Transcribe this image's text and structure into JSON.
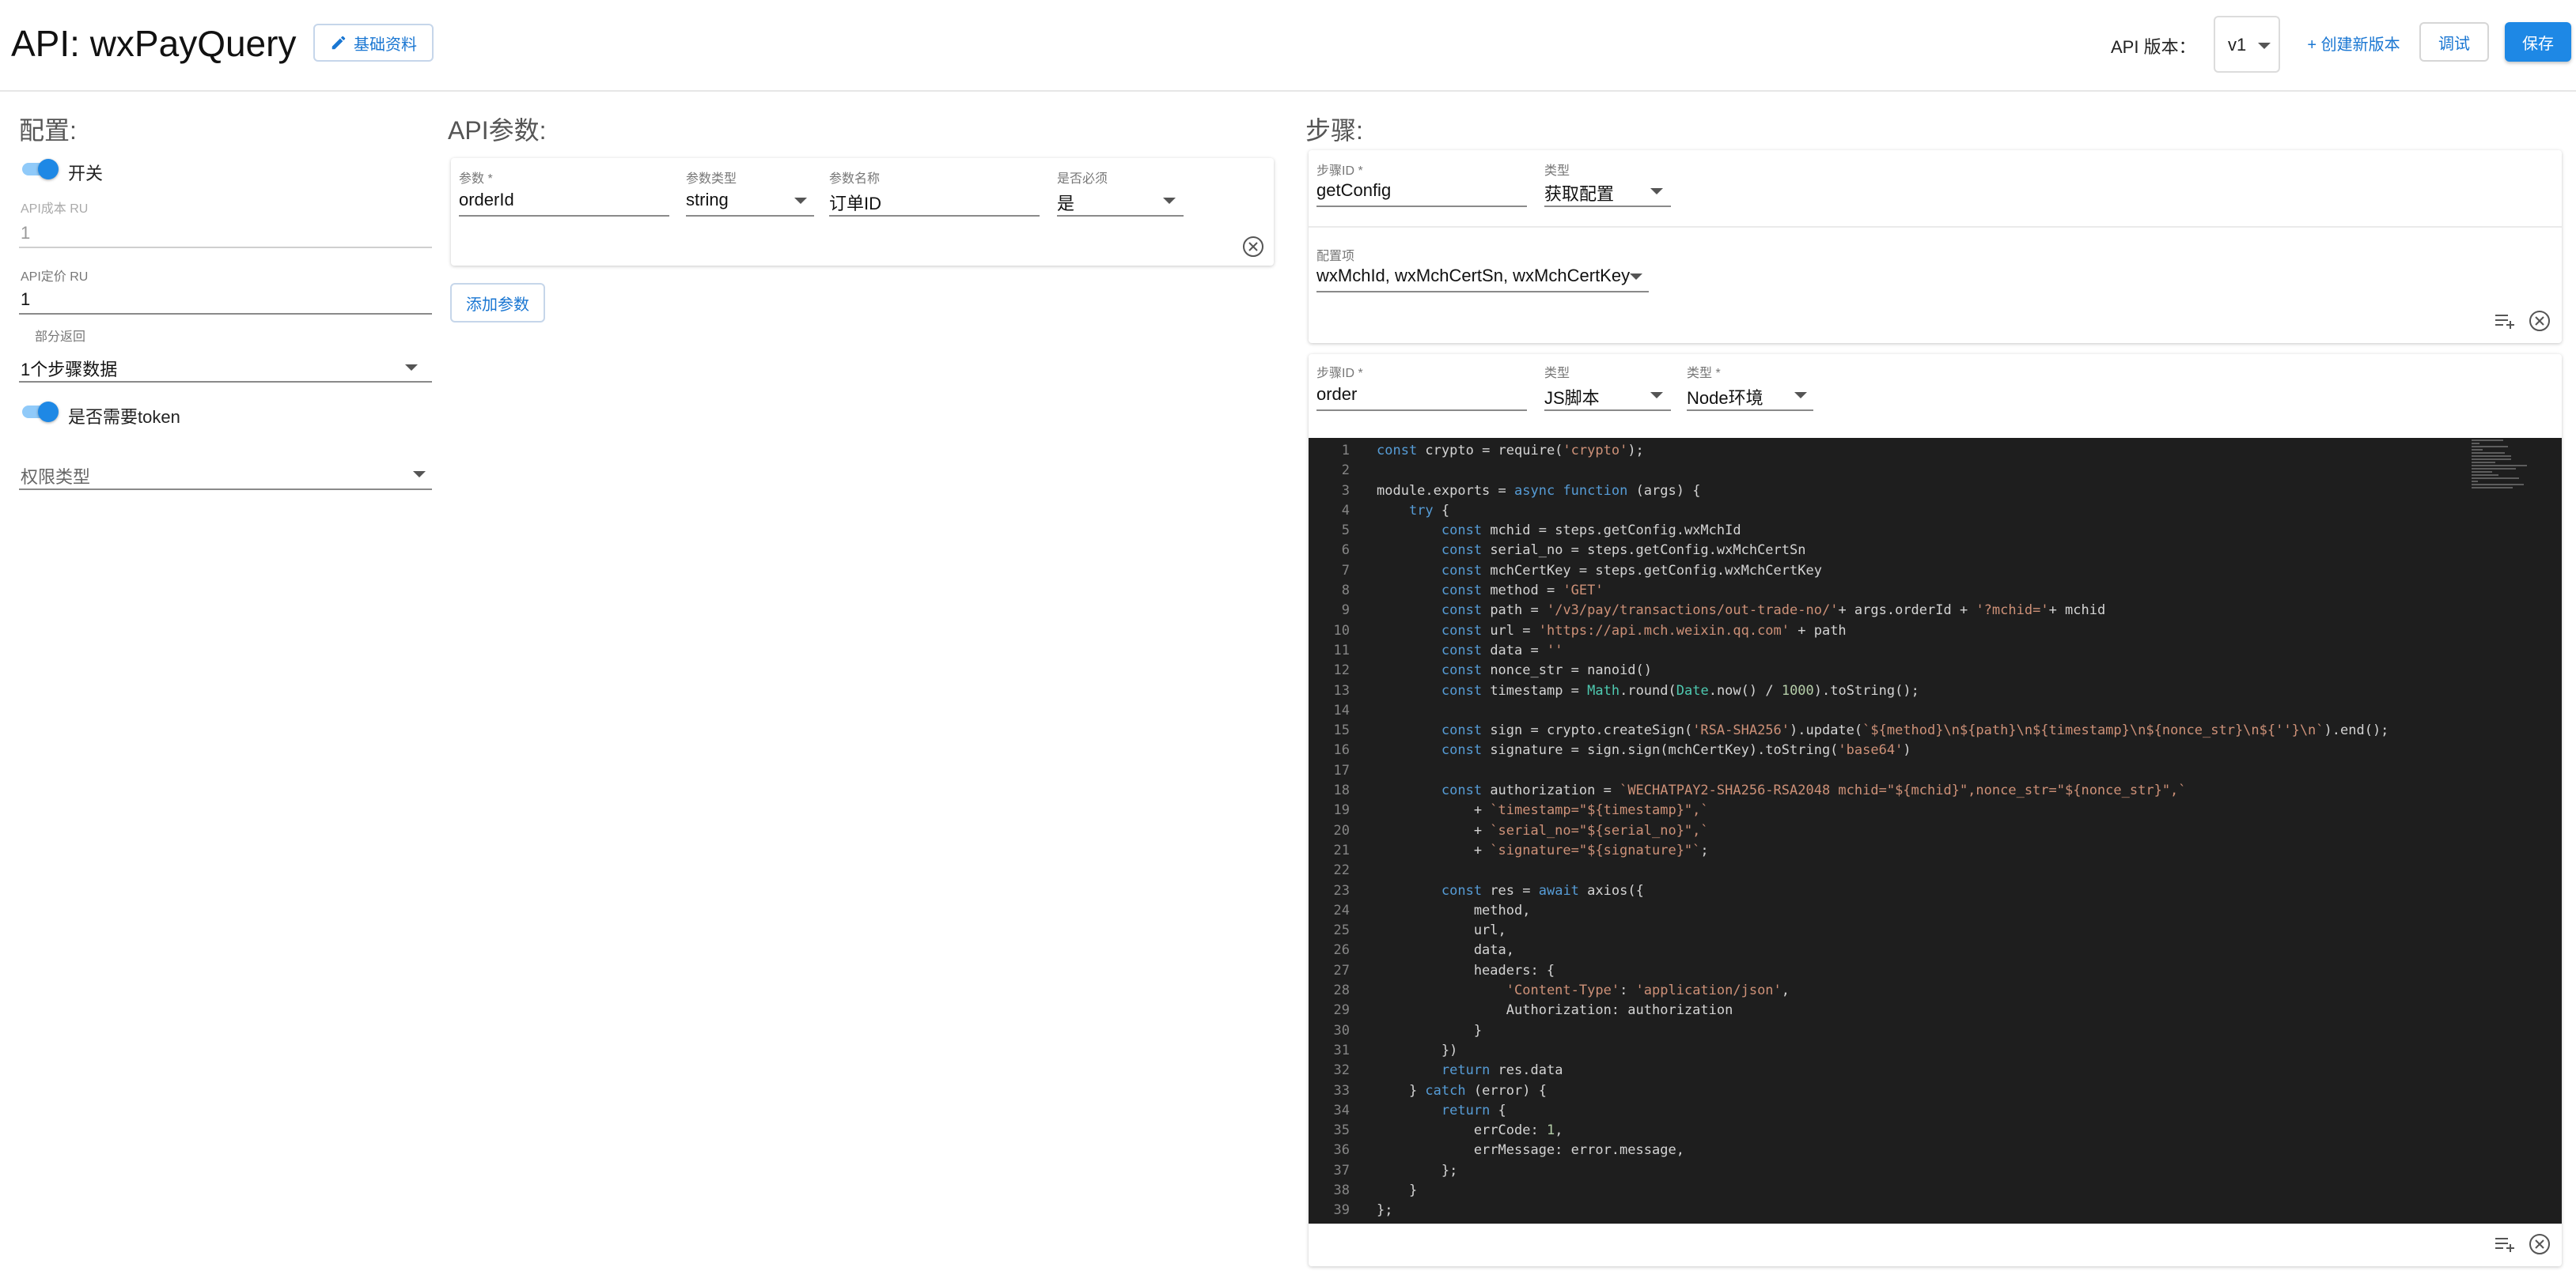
{
  "header": {
    "title": "API: wxPayQuery",
    "basic_info_label": "基础资料",
    "version_label": "API 版本：",
    "version_value": "v1",
    "create_version_label": "+ 创建新版本",
    "debug_label": "调试",
    "save_label": "保存"
  },
  "config": {
    "title": "配置:",
    "switch_label": "开关",
    "cost_label": "API成本 RU",
    "cost_value": "1",
    "price_label": "API定价 RU",
    "price_value": "1",
    "partial_return_label": "部分返回",
    "partial_return_value": "1个步骤数据",
    "token_label": "是否需要token",
    "permission_placeholder": "权限类型"
  },
  "params": {
    "title": "API参数:",
    "headers": {
      "param": "参数 *",
      "type": "参数类型",
      "name": "参数名称",
      "required": "是否必须"
    },
    "rows": [
      {
        "param": "orderId",
        "type": "string",
        "name": "订单ID",
        "required": "是"
      }
    ],
    "add_label": "添加参数"
  },
  "steps": {
    "title": "步骤:",
    "step1": {
      "id_label": "步骤ID *",
      "id_value": "getConfig",
      "type_label": "类型",
      "type_value": "获取配置",
      "config_label": "配置项",
      "config_value": "wxMchId, wxMchCertSn, wxMchCertKey"
    },
    "step2": {
      "id_label": "步骤ID *",
      "id_value": "order",
      "type_label": "类型",
      "type_value": "JS脚本",
      "env_label": "类型 *",
      "env_value": "Node环境"
    }
  },
  "code": [
    "const crypto = require('crypto');",
    "",
    "module.exports = async function (args) {",
    "    try {",
    "        const mchid = steps.getConfig.wxMchId",
    "        const serial_no = steps.getConfig.wxMchCertSn",
    "        const mchCertKey = steps.getConfig.wxMchCertKey",
    "        const method = 'GET'",
    "        const path = '/v3/pay/transactions/out-trade-no/'+ args.orderId + '?mchid='+ mchid",
    "        const url = 'https://api.mch.weixin.qq.com' + path",
    "        const data = ''",
    "        const nonce_str = nanoid()",
    "        const timestamp = Math.round(Date.now() / 1000).toString();",
    "",
    "        const sign = crypto.createSign('RSA-SHA256').update(`${method}\\n${path}\\n${timestamp}\\n${nonce_str}\\n${''}\\n`).end();",
    "        const signature = sign.sign(mchCertKey).toString('base64')",
    "",
    "        const authorization = `WECHATPAY2-SHA256-RSA2048 mchid=\"${mchid}\",nonce_str=\"${nonce_str}\",`",
    "            + `timestamp=\"${timestamp}\",`",
    "            + `serial_no=\"${serial_no}\",`",
    "            + `signature=\"${signature}\"`;",
    "",
    "        const res = await axios({",
    "            method,",
    "            url,",
    "            data,",
    "            headers: {",
    "                'Content-Type': 'application/json',",
    "                Authorization: authorization",
    "            }",
    "        })",
    "        return res.data",
    "    } catch (error) {",
    "        return {",
    "            errCode: 1,",
    "            errMessage: error.message,",
    "        };",
    "    }",
    "};"
  ],
  "colors": {
    "primary": "#1e88e5",
    "editor_bg": "#1e1e1e",
    "keyword": "#569cd6",
    "string": "#ce9178",
    "number": "#b5cea8"
  }
}
